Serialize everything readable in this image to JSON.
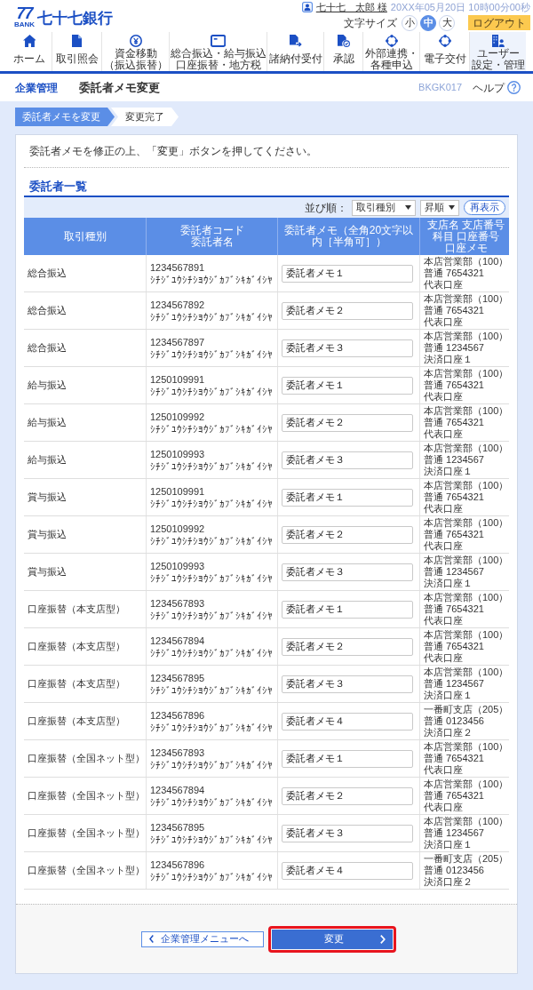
{
  "header": {
    "logo": {
      "mark": "77",
      "sub": "BANK",
      "name": "七十七銀行"
    },
    "user": {
      "name": "七十七　太郎 様",
      "datetime": "20XX年05月20日 10時00分00秒"
    },
    "text_size": {
      "label": "文字サイズ",
      "options": [
        {
          "label": "小",
          "selected": false
        },
        {
          "label": "中",
          "selected": true
        },
        {
          "label": "大",
          "selected": false
        }
      ]
    },
    "logout": "ログアウト"
  },
  "nav": [
    {
      "label": "ホーム",
      "selected": false
    },
    {
      "label": "取引照会",
      "selected": false
    },
    {
      "label": "資金移動（振込振替）",
      "selected": false
    },
    {
      "label": "総合振込・給与振込口座振替・地方税",
      "selected": false
    },
    {
      "label": "諸納付受付",
      "selected": false
    },
    {
      "label": "承認",
      "selected": false
    },
    {
      "label": "外部連携・各種申込",
      "selected": false
    },
    {
      "label": "電子交付",
      "selected": false
    },
    {
      "label": "ユーザー設定・管理",
      "selected": true
    }
  ],
  "page_header": {
    "section": "企業管理",
    "title": "委託者メモ変更",
    "screen_id": "BKGK017",
    "help": "ヘルプ"
  },
  "steps": [
    {
      "label": "委託者メモを変更",
      "selected": true
    },
    {
      "label": "変更完了",
      "selected": false
    }
  ],
  "instruction": "委託者メモを修正の上、「変更」ボタンを押してください。",
  "section_title": "委託者一覧",
  "sort": {
    "label": "並び順：",
    "field": "取引種別",
    "order": "昇順",
    "refresh": "再表示"
  },
  "table": {
    "columns": [
      [
        "取引種別"
      ],
      [
        "委託者コード",
        "委託者名"
      ],
      [
        "委託者メモ（全角20文字以内［半角可］）"
      ],
      [
        "支店名 支店番号",
        "科目 口座番号",
        "口座メモ"
      ]
    ],
    "rows": [
      {
        "type": "総合振込",
        "code": "1234567891",
        "name": "ｼﾁｼﾞﾕｳｼﾁｼﾖｳｼﾞｶﾌﾞｼｷｶﾞｲｼﾔ",
        "memo": "委託者メモ１",
        "branch": "本店営業部（100）",
        "account": "普通 7654321",
        "account_memo": "代表口座"
      },
      {
        "type": "総合振込",
        "code": "1234567892",
        "name": "ｼﾁｼﾞﾕｳｼﾁｼﾖｳｼﾞｶﾌﾞｼｷｶﾞｲｼﾔ",
        "memo": "委託者メモ２",
        "branch": "本店営業部（100）",
        "account": "普通 7654321",
        "account_memo": "代表口座"
      },
      {
        "type": "総合振込",
        "code": "1234567897",
        "name": "ｼﾁｼﾞﾕｳｼﾁｼﾖｳｼﾞｶﾌﾞｼｷｶﾞｲｼﾔ",
        "memo": "委託者メモ３",
        "branch": "本店営業部（100）",
        "account": "普通 1234567",
        "account_memo": "決済口座１"
      },
      {
        "type": "給与振込",
        "code": "1250109991",
        "name": "ｼﾁｼﾞﾕｳｼﾁｼﾖｳｼﾞｶﾌﾞｼｷｶﾞｲｼﾔ",
        "memo": "委託者メモ１",
        "branch": "本店営業部（100）",
        "account": "普通 7654321",
        "account_memo": "代表口座"
      },
      {
        "type": "給与振込",
        "code": "1250109992",
        "name": "ｼﾁｼﾞﾕｳｼﾁｼﾖｳｼﾞｶﾌﾞｼｷｶﾞｲｼﾔ",
        "memo": "委託者メモ２",
        "branch": "本店営業部（100）",
        "account": "普通 7654321",
        "account_memo": "代表口座"
      },
      {
        "type": "給与振込",
        "code": "1250109993",
        "name": "ｼﾁｼﾞﾕｳｼﾁｼﾖｳｼﾞｶﾌﾞｼｷｶﾞｲｼﾔ",
        "memo": "委託者メモ３",
        "branch": "本店営業部（100）",
        "account": "普通 1234567",
        "account_memo": "決済口座１"
      },
      {
        "type": "賞与振込",
        "code": "1250109991",
        "name": "ｼﾁｼﾞﾕｳｼﾁｼﾖｳｼﾞｶﾌﾞｼｷｶﾞｲｼﾔ",
        "memo": "委託者メモ１",
        "branch": "本店営業部（100）",
        "account": "普通 7654321",
        "account_memo": "代表口座"
      },
      {
        "type": "賞与振込",
        "code": "1250109992",
        "name": "ｼﾁｼﾞﾕｳｼﾁｼﾖｳｼﾞｶﾌﾞｼｷｶﾞｲｼﾔ",
        "memo": "委託者メモ２",
        "branch": "本店営業部（100）",
        "account": "普通 7654321",
        "account_memo": "代表口座"
      },
      {
        "type": "賞与振込",
        "code": "1250109993",
        "name": "ｼﾁｼﾞﾕｳｼﾁｼﾖｳｼﾞｶﾌﾞｼｷｶﾞｲｼﾔ",
        "memo": "委託者メモ３",
        "branch": "本店営業部（100）",
        "account": "普通 1234567",
        "account_memo": "決済口座１"
      },
      {
        "type": "口座振替（本支店型）",
        "code": "1234567893",
        "name": "ｼﾁｼﾞﾕｳｼﾁｼﾖｳｼﾞｶﾌﾞｼｷｶﾞｲｼﾔ",
        "memo": "委託者メモ１",
        "branch": "本店営業部（100）",
        "account": "普通 7654321",
        "account_memo": "代表口座"
      },
      {
        "type": "口座振替（本支店型）",
        "code": "1234567894",
        "name": "ｼﾁｼﾞﾕｳｼﾁｼﾖｳｼﾞｶﾌﾞｼｷｶﾞｲｼﾔ",
        "memo": "委託者メモ２",
        "branch": "本店営業部（100）",
        "account": "普通 7654321",
        "account_memo": "代表口座"
      },
      {
        "type": "口座振替（本支店型）",
        "code": "1234567895",
        "name": "ｼﾁｼﾞﾕｳｼﾁｼﾖｳｼﾞｶﾌﾞｼｷｶﾞｲｼﾔ",
        "memo": "委託者メモ３",
        "branch": "本店営業部（100）",
        "account": "普通 1234567",
        "account_memo": "決済口座１"
      },
      {
        "type": "口座振替（本支店型）",
        "code": "1234567896",
        "name": "ｼﾁｼﾞﾕｳｼﾁｼﾖｳｼﾞｶﾌﾞｼｷｶﾞｲｼﾔ",
        "memo": "委託者メモ４",
        "branch": "一番町支店（205）",
        "account": "普通 0123456",
        "account_memo": "決済口座２"
      },
      {
        "type": "口座振替（全国ネット型）",
        "code": "1234567893",
        "name": "ｼﾁｼﾞﾕｳｼﾁｼﾖｳｼﾞｶﾌﾞｼｷｶﾞｲｼﾔ",
        "memo": "委託者メモ１",
        "branch": "本店営業部（100）",
        "account": "普通 7654321",
        "account_memo": "代表口座"
      },
      {
        "type": "口座振替（全国ネット型）",
        "code": "1234567894",
        "name": "ｼﾁｼﾞﾕｳｼﾁｼﾖｳｼﾞｶﾌﾞｼｷｶﾞｲｼﾔ",
        "memo": "委託者メモ２",
        "branch": "本店営業部（100）",
        "account": "普通 7654321",
        "account_memo": "代表口座"
      },
      {
        "type": "口座振替（全国ネット型）",
        "code": "1234567895",
        "name": "ｼﾁｼﾞﾕｳｼﾁｼﾖｳｼﾞｶﾌﾞｼｷｶﾞｲｼﾔ",
        "memo": "委託者メモ３",
        "branch": "本店営業部（100）",
        "account": "普通 1234567",
        "account_memo": "決済口座１"
      },
      {
        "type": "口座振替（全国ネット型）",
        "code": "1234567896",
        "name": "ｼﾁｼﾞﾕｳｼﾁｼﾖｳｼﾞｶﾌﾞｼｷｶﾞｲｼﾔ",
        "memo": "委託者メモ４",
        "branch": "一番町支店（205）",
        "account": "普通 0123456",
        "account_memo": "決済口座２"
      }
    ]
  },
  "buttons": [
    {
      "label": "企業管理メニューへ",
      "kind": "back",
      "highlighted": false
    },
    {
      "label": "変更",
      "kind": "submit",
      "highlighted": true
    }
  ]
}
